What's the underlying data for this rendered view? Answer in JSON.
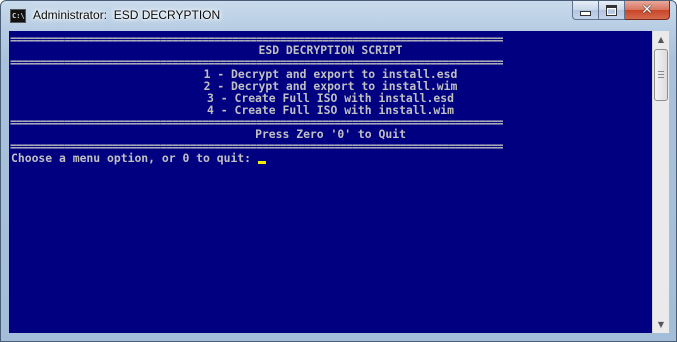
{
  "window": {
    "title": "Administrator:  ESD DECRYPTION",
    "app_icon": "cmd-icon",
    "controls": {
      "minimize": "minimize-icon",
      "maximize": "maximize-icon",
      "close": "✕"
    }
  },
  "console": {
    "colors": {
      "background": "#000080",
      "text": "#c0c0c0",
      "cursor": "#f0f000"
    },
    "separator": "==================================================================================",
    "header": "ESD DECRYPTION SCRIPT",
    "menu_items": [
      "1 - Decrypt and export to install.esd",
      "2 - Decrypt and export to install.wim",
      "3 - Create Full ISO with install.esd",
      "4 - Create Full ISO with install.wim"
    ],
    "quit_hint": "Press Zero '0' to Quit",
    "prompt": "Choose a menu option, or 0 to quit: "
  }
}
